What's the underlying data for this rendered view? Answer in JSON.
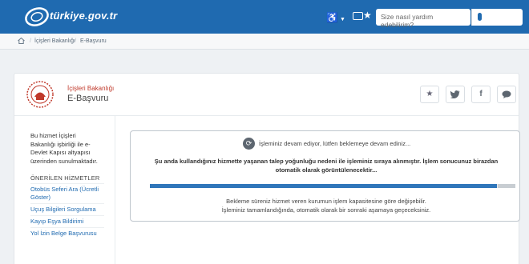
{
  "header": {
    "logo_text": "türkiye.gov.tr",
    "search_placeholder": "Size nasıl yardım edebilirim?",
    "accessibility_icon": "accessibility-icon",
    "brand_color": "#1f6ab0"
  },
  "breadcrumb": {
    "items": [
      "İçişleri Bakanlığı",
      "E-Başvuru"
    ]
  },
  "service": {
    "institution": "İçişleri Bakanlığı",
    "name": "E-Başvuru"
  },
  "sidebar": {
    "intro": "Bu hizmet İçişleri Bakanlığı işbirliği ile e-Devlet Kapısı altyapısı üzerinden sunulmaktadır.",
    "recommended_heading": "ÖNERİLEN HİZMETLER",
    "links": [
      "Otobüs Seferi Ara (Ücretli Göster)",
      "Uçuş Bilgileri Sorgulama",
      "Kayıp Eşya Bildirimi",
      "Yol İzin Belge Başvurusu"
    ]
  },
  "processing": {
    "title": "İşleminiz devam ediyor, lütfen beklemeye devam ediniz...",
    "notice": "Şu anda kullandığınız hizmette yaşanan talep yoğunluğu nedeni ile işleminiz sıraya alınmıştır. İşlem sonucunuz birazdan otomatik olarak görüntülenecektir...",
    "progress": 0.95,
    "info_line1": "Bekleme süreniz hizmet veren kurumun işlem kapasitesine göre değişebilir.",
    "info_line2": "İşleminiz tamamlandığında, otomatik olarak bir sonraki aşamaya geçeceksiniz."
  }
}
